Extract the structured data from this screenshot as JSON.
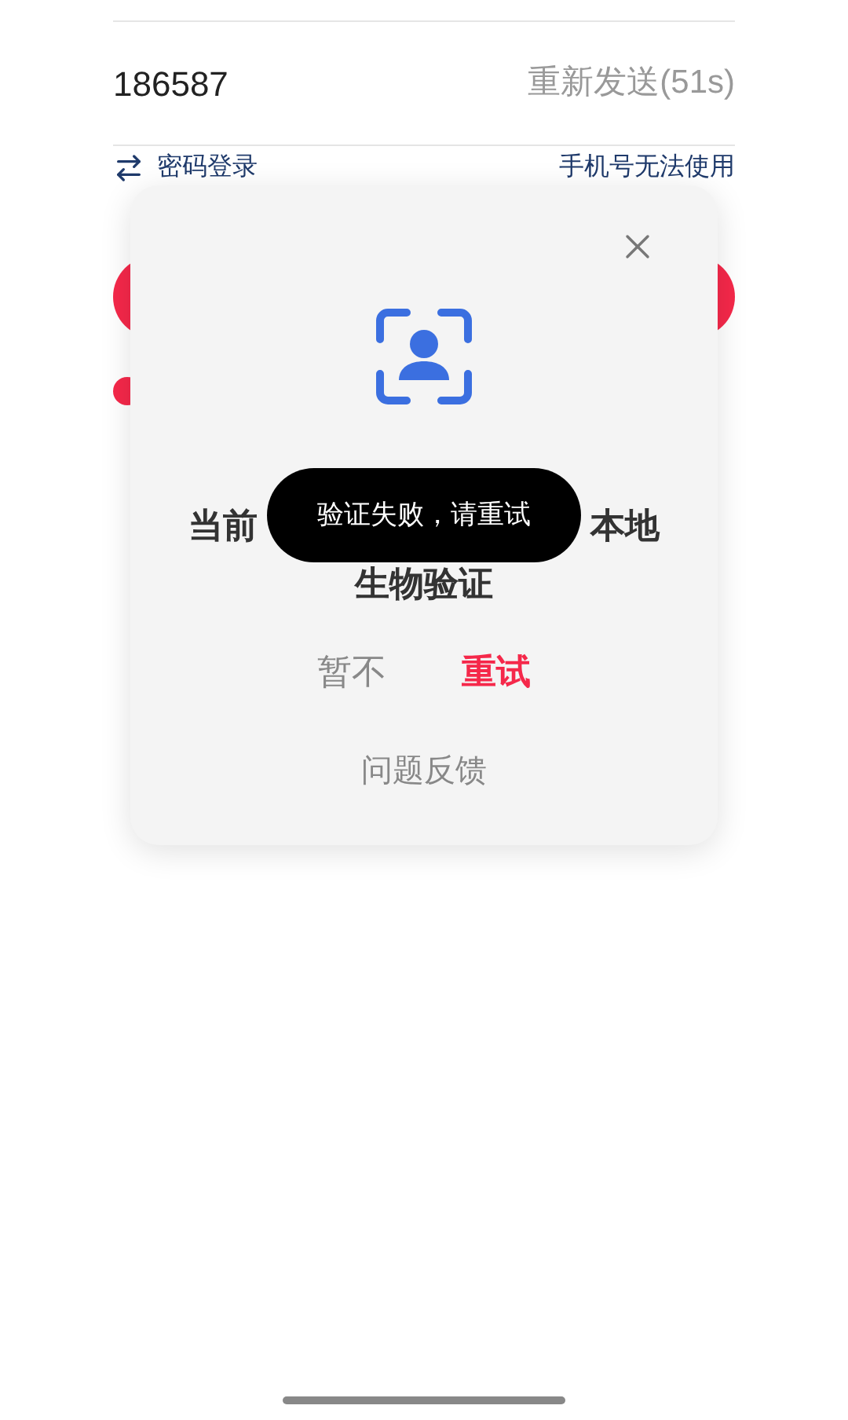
{
  "form": {
    "code": "186587",
    "resend": "重新发送(51s)",
    "password_login": "密码登录",
    "phone_unavailable": "手机号无法使用",
    "agree_checked": true
  },
  "dialog": {
    "title_start": "当前",
    "title_end": "本地",
    "title_line2": "生物验证",
    "buttons": [
      {
        "label": "暂不",
        "kind": "secondary"
      },
      {
        "label": "重试",
        "kind": "primary"
      }
    ],
    "feedback": "问题反馈"
  },
  "toast": "验证失败，请重试"
}
